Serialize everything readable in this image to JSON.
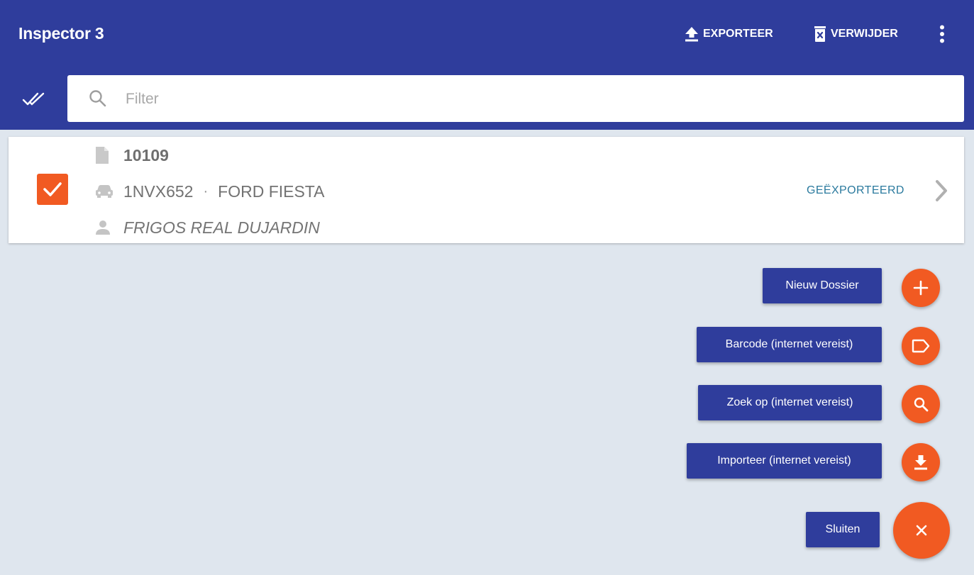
{
  "appbar": {
    "title": "Inspector 3",
    "export_label": "EXPORTEER",
    "delete_label": "VERWIJDER",
    "export_icon": "upload-icon",
    "delete_icon": "delete-file-icon",
    "more_icon": "more-vert-icon"
  },
  "filter": {
    "placeholder": "Filter",
    "value": "",
    "select_all_icon": "double-check-icon"
  },
  "dossiers": [
    {
      "checked": true,
      "number": "10109",
      "plate": "1NVX652",
      "separator": "·",
      "vehicle": "FORD FIESTA",
      "client": "FRIGOS REAL DUJARDIN",
      "status": "GEËXPORTEERD"
    }
  ],
  "speed_dial": {
    "actions": [
      {
        "label": "Nieuw Dossier",
        "icon": "plus-icon"
      },
      {
        "label": "Barcode (internet vereist)",
        "icon": "label-icon"
      },
      {
        "label": "Zoek op (internet vereist)",
        "icon": "search-icon"
      },
      {
        "label": "Importeer (internet vereist)",
        "icon": "download-icon"
      }
    ],
    "close_label": "Sluiten",
    "close_icon": "close-icon"
  },
  "colors": {
    "primary": "#2f3d9c",
    "accent": "#f15a22",
    "background": "#dfe6ee",
    "status_text": "#2b7a9e"
  }
}
